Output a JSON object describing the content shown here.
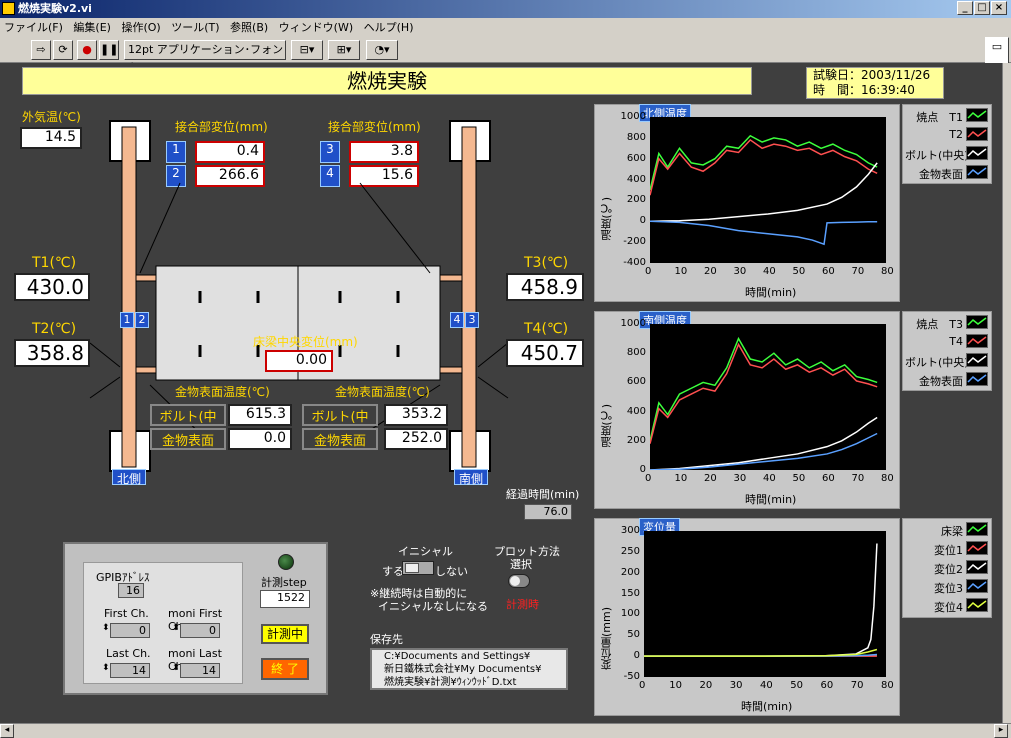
{
  "window": {
    "title": "燃焼実験v2.vi"
  },
  "menu": [
    "ファイル(F)",
    "編集(E)",
    "操作(O)",
    "ツール(T)",
    "参照(B)",
    "ウィンドウ(W)",
    "ヘルプ(H)"
  ],
  "toolbar": {
    "font": "12pt アプリケーション･フォント"
  },
  "header": {
    "title": "燃焼実験",
    "test_date": "試験日：2003/11/26",
    "time": "時　間：16:39:40"
  },
  "left": {
    "outside_temp_label": "外気温(℃)",
    "outside_temp": "14.5",
    "joint_label_l": "接合部変位(mm)",
    "joint_label_r": "接合部変位(mm)",
    "d1": "0.4",
    "d2": "266.6",
    "d3": "3.8",
    "d4": "15.6",
    "t1_label": "T1(℃)",
    "t1": "430.0",
    "t2_label": "T2(℃)",
    "t2": "358.8",
    "t3_label": "T3(℃)",
    "t3": "458.9",
    "t4_label": "T4(℃)",
    "t4": "450.7",
    "beam_label": "床梁中央変位(mm)",
    "beam": "0.00",
    "metal_label_l": "金物表面温度(℃)",
    "metal_label_r": "金物表面温度(℃)",
    "bolt": "ボルト(中央)",
    "metal": "金物表面",
    "bolt_l": "615.3",
    "metal_l": "0.0",
    "bolt_r": "353.2",
    "metal_r": "252.0",
    "north": "北側",
    "south": "南側",
    "elapsed_label": "経過時間(min)",
    "elapsed": "76.0"
  },
  "control": {
    "gpib_label": "GPIBｱﾄﾞﾚｽ",
    "gpib": "16",
    "first_label": "First Ch.",
    "first": "0",
    "moni_first_label": "moni First Ch.",
    "moni_first": "0",
    "last_label": "Last Ch.",
    "last": "14",
    "moni_last_label": "moni Last Ch.",
    "moni_last": "14",
    "step_label": "計測step",
    "step": "1522",
    "measuring": "計測中",
    "end": "終 了"
  },
  "initial": {
    "label": "イニシャル",
    "yes": "する",
    "no": "しない",
    "note1": "※継続時は自動的に",
    "note2": "イニシャルなしになる"
  },
  "plot_method": {
    "label1": "プロット方法",
    "label2": "選択",
    "state": "計測時"
  },
  "save": {
    "label": "保存先",
    "l1": "C:¥Documents and Settings¥",
    "l2": "新日鐵株式会社¥My Documents¥",
    "l3": "燃焼実験¥計測¥ｳｨﾝｳｯﾄﾞD.txt"
  },
  "chart_data": [
    {
      "type": "line",
      "title": "北側温度",
      "xlabel": "時間(min)",
      "ylabel": "温度(℃)",
      "xlim": [
        0,
        80
      ],
      "ylim": [
        -400,
        1000
      ],
      "xticks": [
        "0",
        "10",
        "20",
        "30",
        "40",
        "50",
        "60",
        "70",
        "80"
      ],
      "yticks": [
        "1000",
        "800",
        "600",
        "400",
        "200",
        "0",
        "-200",
        "-400"
      ],
      "series": [
        {
          "name": "焼点　T1",
          "color": "#3cff3c",
          "x": [
            0,
            3,
            6,
            10,
            14,
            18,
            22,
            26,
            30,
            34,
            38,
            42,
            46,
            50,
            54,
            58,
            62,
            66,
            70,
            74,
            77
          ],
          "y": [
            300,
            650,
            520,
            700,
            560,
            540,
            600,
            720,
            700,
            820,
            760,
            800,
            780,
            720,
            760,
            700,
            740,
            680,
            640,
            560,
            520
          ]
        },
        {
          "name": "T2",
          "color": "#ff5050",
          "x": [
            0,
            3,
            6,
            10,
            14,
            18,
            22,
            26,
            30,
            34,
            38,
            42,
            46,
            50,
            54,
            58,
            62,
            66,
            70,
            74,
            77
          ],
          "y": [
            250,
            600,
            500,
            650,
            520,
            480,
            560,
            680,
            660,
            780,
            700,
            740,
            720,
            680,
            700,
            640,
            680,
            620,
            580,
            500,
            460
          ]
        },
        {
          "name": "ボルト(中央)",
          "color": "#ffffff",
          "x": [
            0,
            10,
            20,
            30,
            40,
            50,
            60,
            65,
            70,
            74,
            77
          ],
          "y": [
            0,
            5,
            20,
            45,
            70,
            105,
            165,
            230,
            330,
            450,
            560
          ]
        },
        {
          "name": "金物表面",
          "color": "#5aa0ff",
          "x": [
            0,
            10,
            20,
            30,
            40,
            50,
            55,
            58,
            59,
            60,
            65,
            70,
            74,
            77
          ],
          "y": [
            0,
            -10,
            -40,
            -90,
            -120,
            -150,
            -180,
            -210,
            -220,
            -15,
            -10,
            -8,
            -5,
            -5
          ]
        }
      ]
    },
    {
      "type": "line",
      "title": "南側温度",
      "xlabel": "時間(min)",
      "ylabel": "温度(℃)",
      "xlim": [
        0,
        80
      ],
      "ylim": [
        0,
        1000
      ],
      "xticks": [
        "0",
        "10",
        "20",
        "30",
        "40",
        "50",
        "60",
        "70",
        "80"
      ],
      "yticks": [
        "1000",
        "800",
        "600",
        "400",
        "200",
        "0"
      ],
      "series": [
        {
          "name": "焼点　T3",
          "color": "#3cff3c",
          "x": [
            0,
            3,
            6,
            10,
            14,
            18,
            22,
            26,
            30,
            34,
            38,
            42,
            46,
            50,
            54,
            58,
            62,
            66,
            70,
            74,
            77
          ],
          "y": [
            200,
            460,
            380,
            520,
            560,
            600,
            580,
            700,
            900,
            760,
            740,
            800,
            720,
            760,
            700,
            740,
            680,
            720,
            640,
            620,
            600
          ]
        },
        {
          "name": "T4",
          "color": "#ff5050",
          "x": [
            0,
            3,
            6,
            10,
            14,
            18,
            22,
            26,
            30,
            34,
            38,
            42,
            46,
            50,
            54,
            58,
            62,
            66,
            70,
            74,
            77
          ],
          "y": [
            180,
            420,
            360,
            480,
            520,
            560,
            540,
            660,
            860,
            720,
            700,
            760,
            690,
            720,
            670,
            700,
            650,
            690,
            610,
            590,
            570
          ]
        },
        {
          "name": "ボルト(中央)",
          "color": "#ffffff",
          "x": [
            0,
            10,
            20,
            30,
            40,
            50,
            60,
            65,
            70,
            74,
            77
          ],
          "y": [
            0,
            10,
            30,
            50,
            80,
            110,
            160,
            200,
            260,
            320,
            360
          ]
        },
        {
          "name": "金物表面",
          "color": "#5aa0ff",
          "x": [
            0,
            10,
            20,
            30,
            40,
            50,
            60,
            65,
            70,
            74,
            77
          ],
          "y": [
            0,
            5,
            20,
            40,
            60,
            80,
            110,
            140,
            180,
            220,
            250
          ]
        }
      ]
    },
    {
      "type": "line",
      "title": "変位量",
      "xlabel": "時間(min)",
      "ylabel": "変位量(mm)",
      "xlim": [
        0,
        80
      ],
      "ylim": [
        -50,
        300
      ],
      "xticks": [
        "0",
        "10",
        "20",
        "30",
        "40",
        "50",
        "60",
        "70",
        "80"
      ],
      "yticks": [
        "300",
        "250",
        "200",
        "150",
        "100",
        "50",
        "0",
        "-50"
      ],
      "series": [
        {
          "name": "床梁",
          "color": "#3cff3c",
          "x": [
            0,
            40,
            60,
            70,
            74,
            77
          ],
          "y": [
            0,
            0,
            0,
            1,
            2,
            3
          ]
        },
        {
          "name": "変位1",
          "color": "#ff5050",
          "x": [
            0,
            40,
            60,
            70,
            74,
            77
          ],
          "y": [
            0,
            0,
            0,
            0,
            0,
            0
          ]
        },
        {
          "name": "変位2",
          "color": "#ffffff",
          "x": [
            0,
            40,
            60,
            70,
            74,
            75,
            76,
            77
          ],
          "y": [
            0,
            0,
            1,
            5,
            20,
            40,
            120,
            270
          ]
        },
        {
          "name": "変位3",
          "color": "#5aa0ff",
          "x": [
            0,
            40,
            60,
            70,
            74,
            77
          ],
          "y": [
            0,
            0,
            0,
            1,
            2,
            4
          ]
        },
        {
          "name": "変位4",
          "color": "#e0ff40",
          "x": [
            0,
            40,
            60,
            70,
            74,
            77
          ],
          "y": [
            0,
            0,
            1,
            4,
            10,
            16
          ]
        }
      ]
    }
  ]
}
